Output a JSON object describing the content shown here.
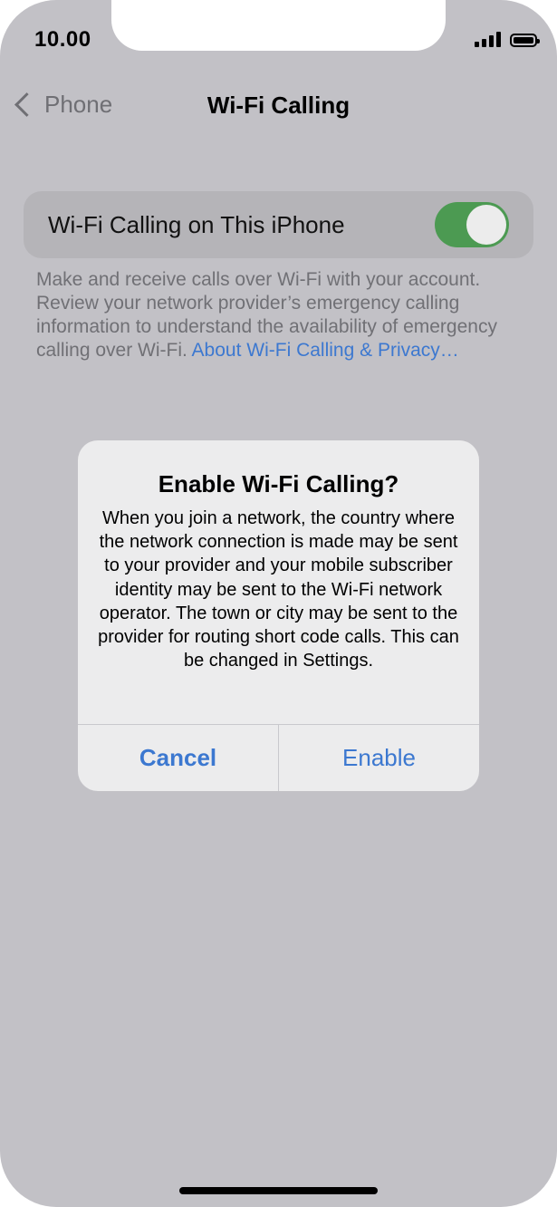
{
  "status_bar": {
    "time": "10.00"
  },
  "nav": {
    "back_label": "Phone",
    "title": "Wi-Fi Calling"
  },
  "setting": {
    "label": "Wi-Fi Calling on This iPhone",
    "toggle_on": true
  },
  "footnote": {
    "text": "Make and receive calls over Wi-Fi with your account. Review your network provider’s emergency calling information to understand the availability of emergency calling over Wi-Fi. ",
    "link": "About Wi-Fi Calling & Privacy…"
  },
  "alert": {
    "title": "Enable Wi-Fi Calling?",
    "body": "When you join a network, the country where the network connection is made may be sent to your provider and your mobile subscriber identity may be sent to the Wi-Fi network operator. The town or city may be sent to the provider for routing short code calls. This can be changed in Settings.",
    "cancel_label": "Cancel",
    "enable_label": "Enable"
  },
  "colors": {
    "accent": "#3c78d0",
    "toggle_on": "#4c9a52",
    "dim_background": "#c2c1c6"
  }
}
